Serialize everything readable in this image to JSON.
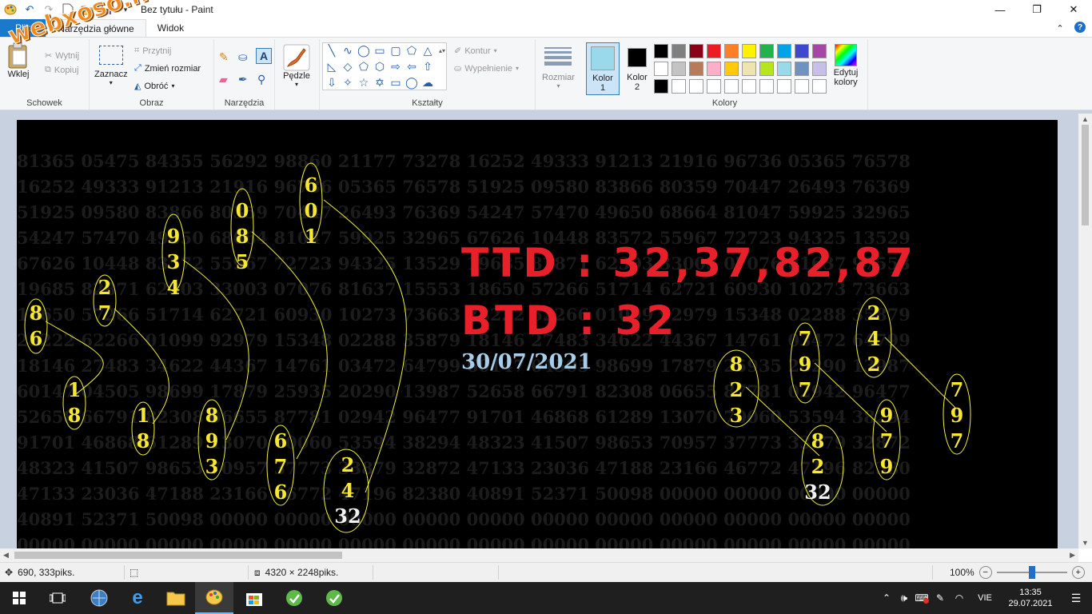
{
  "window": {
    "title": "Bez tytułu - Paint",
    "quick_access": [
      "undo-icon",
      "redo-icon",
      "new-file-icon",
      "open-icon",
      "save-icon",
      "customize-icon"
    ],
    "controls": {
      "minimize": "—",
      "restore": "❐",
      "close": "✕"
    }
  },
  "tabs": [
    {
      "label": "Plik"
    },
    {
      "label": "Narzędzia główne"
    },
    {
      "label": "Widok"
    }
  ],
  "ribbon": {
    "clipboard": {
      "group_label": "Schowek",
      "paste": "Wklej",
      "cut": "Wytnij",
      "copy": "Kopiuj"
    },
    "image": {
      "group_label": "Obraz",
      "select": "Zaznacz",
      "crop": "Przytnij",
      "resize": "Zmień rozmiar",
      "rotate": "Obróć"
    },
    "tools": {
      "group_label": "Narzędzia"
    },
    "brushes": {
      "label": "Pędzle"
    },
    "shapes": {
      "group_label": "Kształty",
      "outline": "Kontur",
      "fill": "Wypełnienie"
    },
    "size": {
      "label": "Rozmiar"
    },
    "colors": {
      "group_label": "Kolory",
      "color1_label": "Kolor 1",
      "color2_label": "Kolor 2",
      "color1": "#99d9ea",
      "color2": "#000000",
      "edit_label": "Edytuj kolory",
      "palette_row1": [
        "#000000",
        "#7f7f7f",
        "#880015",
        "#ed1c24",
        "#ff7f27",
        "#fff200",
        "#22b14c",
        "#00a2e8",
        "#3f48cc",
        "#a349a4"
      ],
      "palette_row2": [
        "#ffffff",
        "#c3c3c3",
        "#b97a57",
        "#ffaec9",
        "#ffc90e",
        "#efe4b0",
        "#b5e61d",
        "#99d9ea",
        "#7092be",
        "#c8bfe7"
      ],
      "palette_row3": [
        "#000000",
        "#ffffff",
        "#ffffff",
        "#ffffff",
        "#ffffff",
        "#ffffff",
        "#ffffff",
        "#ffffff",
        "#ffffff",
        "#ffffff"
      ]
    }
  },
  "watermark": {
    "text": "webxoso.net"
  },
  "image_content": {
    "background_numbers": [
      "81365 05475 84355 56292 98860 21177 73278 16252 49333 91213 21916 96736 05365 76578",
      "16252 49333 91213 21916 96736 05365 76578 51925 09580 83866 80359 70447 26493 76369",
      "51925 09580 83866 80359 70447 26493 76369 54247 57470 49650 68664 81047 59925 32965",
      "54247 57470 49650 68664 81047 59925 32965 67626 10448 83572 55967 72723 94325 13529",
      "67626 10448 83572 55967 72723 94325 13529 19685 82871 62303 33003 07076 81637 97553",
      "19685 82871 62303 33003 07076 81637 15553 18650 57266 51714 62721 60930 10273 73663",
      "18650 57266 51714 62721 60930 10273 73663 28222 62266 01099 92979 15348 02288 35879",
      "28222 62266 01099 92979 15348 02288 35879 18146 27483 34622 44367 14761 03472 64799",
      "18146 27483 34622 44367 14761 03472 64799 60147 04505 98699 17879 25935 20290 13987",
      "60147 04505 98699 17879 25935 20290 13987 52658 66791 82308 06655 87781 02942 96477",
      "52658 66791 82308 06655 87781 02942 96477 91701 46868 61289 13070 70060 53594 38294",
      "91701 46868 61289 13070 70060 53594 38294 48323 41507 98653 70957 37773 33879 32872",
      "48323 41507 98653 70957 37773 33879 32872 47133 23036 47188 23166 46772 47196 82380",
      "47133 23036 47188 23166 46772 47196 82380 40891 52371 50098 00000 00000 00000 00000",
      "40891 52371 50098 00000 00000 00000 00000 00000 00000 00000 00000 00000 00000 00000",
      "00000 00000 00000 00000 00000 00000 00000 00000 00000 00000 00000 00000 00000 00000"
    ],
    "headline1": "TTD : 32,37,82,87",
    "headline2": "BTD : 32",
    "date": "30/07/2021",
    "columns": [
      {
        "digits": [
          "8",
          "6"
        ]
      },
      {
        "digits": [
          "1",
          "8"
        ]
      },
      {
        "digits": [
          "2",
          "7"
        ]
      },
      {
        "digits": [
          "1",
          "8"
        ]
      },
      {
        "digits": [
          "9",
          "3",
          "4"
        ]
      },
      {
        "digits": [
          "8",
          "9",
          "3"
        ]
      },
      {
        "digits": [
          "0",
          "8",
          "5"
        ]
      },
      {
        "digits": [
          "6",
          "7",
          "6"
        ]
      },
      {
        "digits": [
          "6",
          "0",
          "1"
        ]
      },
      {
        "digits": [
          "2",
          "4",
          "32"
        ]
      },
      {
        "digits": [
          "8",
          "2",
          "3"
        ]
      },
      {
        "digits": [
          "8",
          "2",
          "32"
        ]
      },
      {
        "digits": [
          "7",
          "9",
          "7"
        ]
      },
      {
        "digits": [
          "9",
          "7",
          "9"
        ]
      },
      {
        "digits": [
          "2",
          "4",
          "2"
        ]
      },
      {
        "digits": [
          "7",
          "9",
          "7"
        ]
      }
    ]
  },
  "statusbar": {
    "cursor_pos": "690, 333piks.",
    "image_size": "4320 × 2248piks.",
    "zoom": "100%",
    "zoom_level": 0.5
  },
  "taskbar": {
    "apps": [
      "windows-start-icon",
      "task-view-icon",
      "browser-globe-icon",
      "edge-icon",
      "file-explorer-icon",
      "paint-icon",
      "store-icon",
      "green-app-icon",
      "green-app-icon-2"
    ],
    "lang": "VIE",
    "time": "13:35",
    "date": "29.07.2021"
  }
}
